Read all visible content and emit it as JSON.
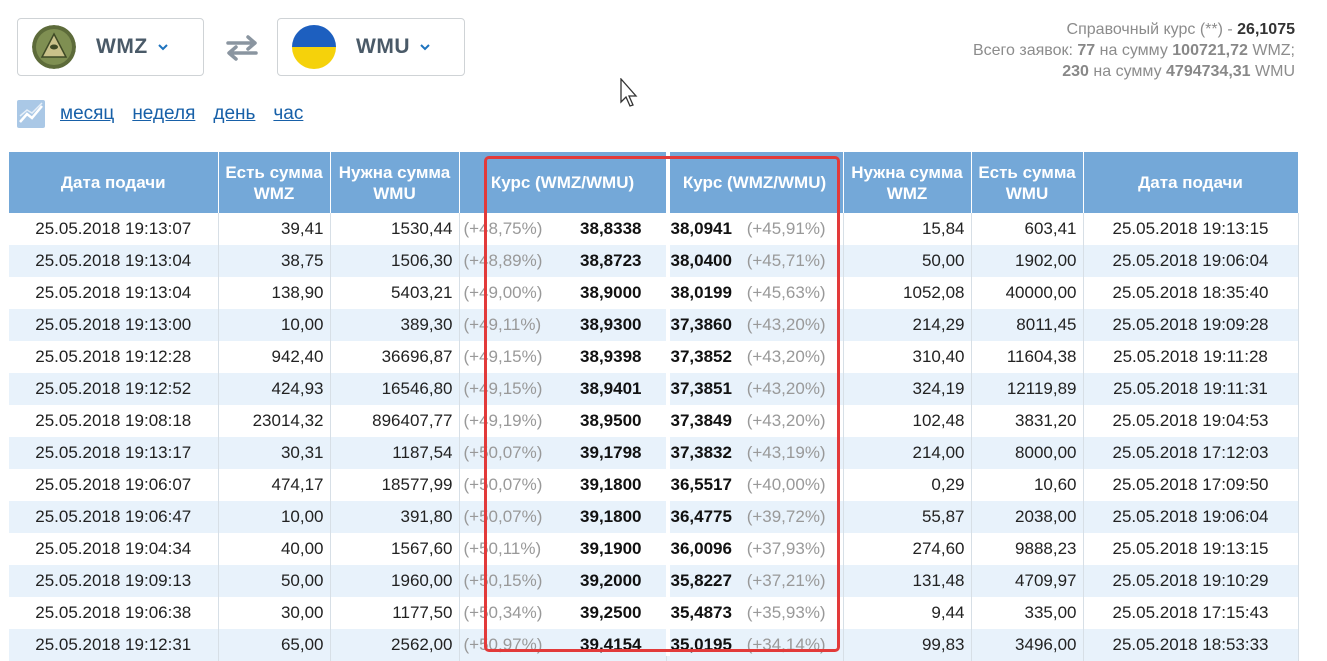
{
  "selectors": {
    "left": {
      "label": "WMZ"
    },
    "right": {
      "label": "WMU"
    }
  },
  "reference": {
    "line1_prefix": "Справочный курс (**) - ",
    "line1_value": "26,1075",
    "line2_prefix": "Всего заявок: ",
    "line2_count": "77",
    "line2_mid": " на сумму ",
    "line2_sum": "100721,72",
    "line2_cur": " WMZ;",
    "line3_count": "230",
    "line3_mid": " на сумму ",
    "line3_sum": "4794734,31",
    "line3_cur": " WMU"
  },
  "periods": [
    "месяц",
    "неделя",
    "день",
    "час"
  ],
  "table": {
    "headers_left": [
      "Дата подачи",
      "Есть сумма WMZ",
      "Нужна сумма WMU",
      "Курс (WMZ/WMU)"
    ],
    "headers_right": [
      "Курс (WMZ/WMU)",
      "Нужна сумма WMZ",
      "Есть сумма WMU",
      "Дата подачи"
    ],
    "rows": [
      {
        "ld": "25.05.2018 19:13:07",
        "lhave": "39,41",
        "lneed": "1530,44",
        "lpct": "(+48,75%)",
        "lrate": "38,8338",
        "rrate": "38,0941",
        "rpct": "(+45,91%)",
        "rneed": "15,84",
        "rhave": "603,41",
        "rd": "25.05.2018 19:13:15"
      },
      {
        "ld": "25.05.2018 19:13:04",
        "lhave": "38,75",
        "lneed": "1506,30",
        "lpct": "(+48,89%)",
        "lrate": "38,8723",
        "rrate": "38,0400",
        "rpct": "(+45,71%)",
        "rneed": "50,00",
        "rhave": "1902,00",
        "rd": "25.05.2018 19:06:04"
      },
      {
        "ld": "25.05.2018 19:13:04",
        "lhave": "138,90",
        "lneed": "5403,21",
        "lpct": "(+49,00%)",
        "lrate": "38,9000",
        "rrate": "38,0199",
        "rpct": "(+45,63%)",
        "rneed": "1052,08",
        "rhave": "40000,00",
        "rd": "25.05.2018 18:35:40"
      },
      {
        "ld": "25.05.2018 19:13:00",
        "lhave": "10,00",
        "lneed": "389,30",
        "lpct": "(+49,11%)",
        "lrate": "38,9300",
        "rrate": "37,3860",
        "rpct": "(+43,20%)",
        "rneed": "214,29",
        "rhave": "8011,45",
        "rd": "25.05.2018 19:09:28"
      },
      {
        "ld": "25.05.2018 19:12:28",
        "lhave": "942,40",
        "lneed": "36696,87",
        "lpct": "(+49,15%)",
        "lrate": "38,9398",
        "rrate": "37,3852",
        "rpct": "(+43,20%)",
        "rneed": "310,40",
        "rhave": "11604,38",
        "rd": "25.05.2018 19:11:28"
      },
      {
        "ld": "25.05.2018 19:12:52",
        "lhave": "424,93",
        "lneed": "16546,80",
        "lpct": "(+49,15%)",
        "lrate": "38,9401",
        "rrate": "37,3851",
        "rpct": "(+43,20%)",
        "rneed": "324,19",
        "rhave": "12119,89",
        "rd": "25.05.2018 19:11:31"
      },
      {
        "ld": "25.05.2018 19:08:18",
        "lhave": "23014,32",
        "lneed": "896407,77",
        "lpct": "(+49,19%)",
        "lrate": "38,9500",
        "rrate": "37,3849",
        "rpct": "(+43,20%)",
        "rneed": "102,48",
        "rhave": "3831,20",
        "rd": "25.05.2018 19:04:53"
      },
      {
        "ld": "25.05.2018 19:13:17",
        "lhave": "30,31",
        "lneed": "1187,54",
        "lpct": "(+50,07%)",
        "lrate": "39,1798",
        "rrate": "37,3832",
        "rpct": "(+43,19%)",
        "rneed": "214,00",
        "rhave": "8000,00",
        "rd": "25.05.2018 17:12:03"
      },
      {
        "ld": "25.05.2018 19:06:07",
        "lhave": "474,17",
        "lneed": "18577,99",
        "lpct": "(+50,07%)",
        "lrate": "39,1800",
        "rrate": "36,5517",
        "rpct": "(+40,00%)",
        "rneed": "0,29",
        "rhave": "10,60",
        "rd": "25.05.2018 17:09:50"
      },
      {
        "ld": "25.05.2018 19:06:47",
        "lhave": "10,00",
        "lneed": "391,80",
        "lpct": "(+50,07%)",
        "lrate": "39,1800",
        "rrate": "36,4775",
        "rpct": "(+39,72%)",
        "rneed": "55,87",
        "rhave": "2038,00",
        "rd": "25.05.2018 19:06:04"
      },
      {
        "ld": "25.05.2018 19:04:34",
        "lhave": "40,00",
        "lneed": "1567,60",
        "lpct": "(+50,11%)",
        "lrate": "39,1900",
        "rrate": "36,0096",
        "rpct": "(+37,93%)",
        "rneed": "274,60",
        "rhave": "9888,23",
        "rd": "25.05.2018 19:13:15"
      },
      {
        "ld": "25.05.2018 19:09:13",
        "lhave": "50,00",
        "lneed": "1960,00",
        "lpct": "(+50,15%)",
        "lrate": "39,2000",
        "rrate": "35,8227",
        "rpct": "(+37,21%)",
        "rneed": "131,48",
        "rhave": "4709,97",
        "rd": "25.05.2018 19:10:29"
      },
      {
        "ld": "25.05.2018 19:06:38",
        "lhave": "30,00",
        "lneed": "1177,50",
        "lpct": "(+50,34%)",
        "lrate": "39,2500",
        "rrate": "35,4873",
        "rpct": "(+35,93%)",
        "rneed": "9,44",
        "rhave": "335,00",
        "rd": "25.05.2018 17:15:43"
      },
      {
        "ld": "25.05.2018 19:12:31",
        "lhave": "65,00",
        "lneed": "2562,00",
        "lpct": "(+50,97%)",
        "lrate": "39,4154",
        "rrate": "35,0195",
        "rpct": "(+34,14%)",
        "rneed": "99,83",
        "rhave": "3496,00",
        "rd": "25.05.2018 18:53:33"
      }
    ]
  }
}
